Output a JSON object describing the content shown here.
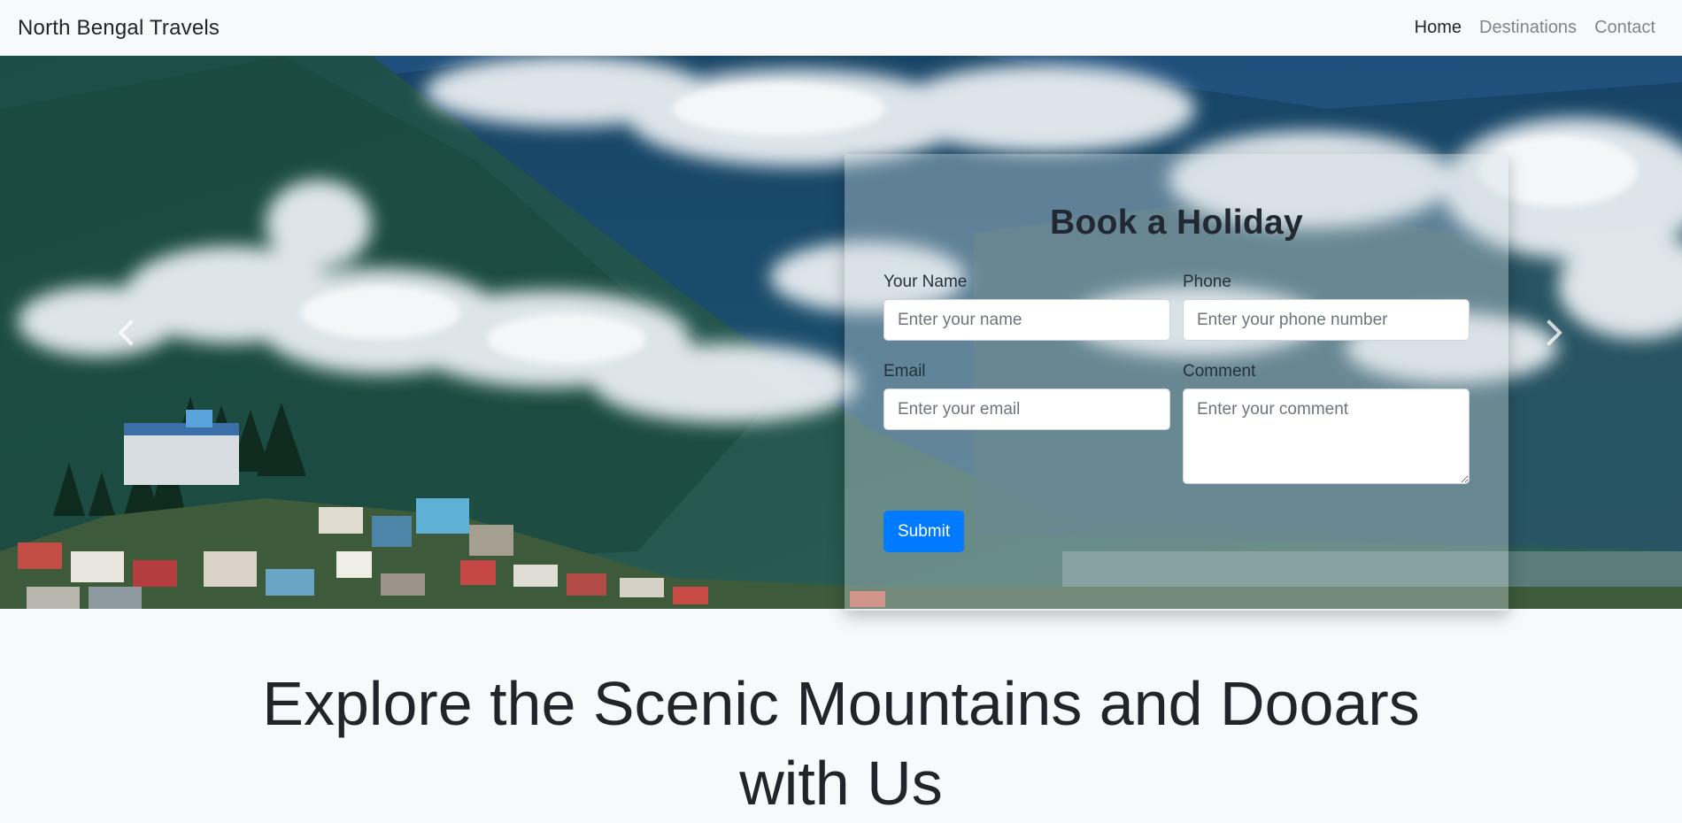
{
  "navbar": {
    "brand": "North Bengal Travels",
    "links": [
      {
        "label": "Home",
        "active": true
      },
      {
        "label": "Destinations",
        "active": false
      },
      {
        "label": "Contact",
        "active": false
      }
    ]
  },
  "hero": {
    "prev_icon": "chevron-left-icon",
    "next_icon": "chevron-right-icon"
  },
  "booking": {
    "title": "Book a Holiday",
    "name": {
      "label": "Your Name",
      "placeholder": "Enter your name",
      "value": ""
    },
    "phone": {
      "label": "Phone",
      "placeholder": "Enter your phone number",
      "value": ""
    },
    "email": {
      "label": "Email",
      "placeholder": "Enter your email",
      "value": ""
    },
    "comment": {
      "label": "Comment",
      "placeholder": "Enter your comment",
      "value": ""
    },
    "submit_label": "Submit"
  },
  "headline": "Explore the Scenic Mountains and Dooars with Us",
  "colors": {
    "primary": "#007bff",
    "navbar_bg": "#f8f9fa",
    "nav_muted": "#7f858b",
    "text_dark": "#212529"
  }
}
